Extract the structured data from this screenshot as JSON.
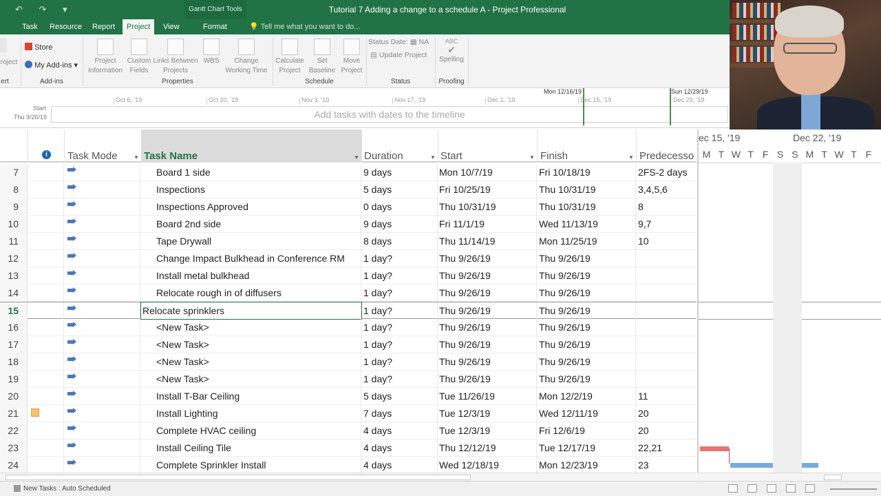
{
  "titlebar": {
    "qat": "↶ ↷ ▾",
    "contextual_tools": "Gantt Chart Tools",
    "doc_title": "Tutorial 7 Adding a change to a schedule A - Project Professional"
  },
  "tabs": [
    "Task",
    "Resource",
    "Report",
    "Project",
    "View",
    "Format"
  ],
  "active_tab": "Project",
  "tell_me": "Tell me what you want to do...",
  "ribbon": {
    "partial_left": "roject",
    "partial_group_left": "ert",
    "store": "Store",
    "my_addins": "My Add-ins",
    "addins_group": "Add-ins",
    "project_information": "Project Information",
    "custom_fields": "Custom Fields",
    "links_between_projects": "Links Between Projects",
    "wbs": "WBS",
    "change_working_time": "Change Working Time",
    "properties_group": "Properties",
    "calculate_project": "Calculate Project",
    "set_baseline": "Set Baseline",
    "move_project": "Move Project",
    "schedule_group": "Schedule",
    "status_date": "Status Date:",
    "status_date_value": "NA",
    "update_project": "Update Project",
    "status_group": "Status",
    "spelling": "Spelling",
    "proofing_group": "Proofing"
  },
  "timeline": {
    "start_label": "Start",
    "start_date": "Thu 9/26/19",
    "placeholder": "Add tasks with dates to the timeline",
    "dates": [
      "Oct 6, '19",
      "Oct 20, '19",
      "Nov 3, '19",
      "Nov 17, '19",
      "Dec 1, '19",
      "Dec 15, '19",
      "Dec 29, '19"
    ],
    "marker_a": "Mon 12/16/19",
    "marker_b": "Sun 12/29/19"
  },
  "columns": {
    "task_mode": "Task Mode",
    "task_name": "Task Name",
    "duration": "Duration",
    "start": "Start",
    "finish": "Finish",
    "predecessors": "Predecesso"
  },
  "editing_value": "Relocate sprinklers",
  "rows": [
    {
      "id": "7",
      "name": "Board 1 side",
      "duration": "9 days",
      "start": "Mon 10/7/19",
      "finish": "Fri 10/18/19",
      "pred": "2FS-2 days"
    },
    {
      "id": "8",
      "name": "Inspections",
      "duration": "5 days",
      "start": "Fri 10/25/19",
      "finish": "Thu 10/31/19",
      "pred": "3,4,5,6"
    },
    {
      "id": "9",
      "name": "Inspections Approved",
      "duration": "0 days",
      "start": "Thu 10/31/19",
      "finish": "Thu 10/31/19",
      "pred": "8"
    },
    {
      "id": "10",
      "name": "Board 2nd side",
      "duration": "9 days",
      "start": "Fri 11/1/19",
      "finish": "Wed 11/13/19",
      "pred": "9,7"
    },
    {
      "id": "11",
      "name": "Tape Drywall",
      "duration": "8 days",
      "start": "Thu 11/14/19",
      "finish": "Mon 11/25/19",
      "pred": "10"
    },
    {
      "id": "12",
      "name": "Change Impact Bulkhead in Conference RM",
      "duration": "1 day?",
      "start": "Thu 9/26/19",
      "finish": "Thu 9/26/19",
      "pred": ""
    },
    {
      "id": "13",
      "name": "Install metal bulkhead",
      "duration": "1 day?",
      "start": "Thu 9/26/19",
      "finish": "Thu 9/26/19",
      "pred": ""
    },
    {
      "id": "14",
      "name": "Relocate rough in of diffusers",
      "duration": "1 day?",
      "start": "Thu 9/26/19",
      "finish": "Thu 9/26/19",
      "pred": ""
    },
    {
      "id": "15",
      "name": "",
      "duration": "1 day?",
      "start": "Thu 9/26/19",
      "finish": "Thu 9/26/19",
      "pred": ""
    },
    {
      "id": "16",
      "name": "<New Task>",
      "duration": "1 day?",
      "start": "Thu 9/26/19",
      "finish": "Thu 9/26/19",
      "pred": ""
    },
    {
      "id": "17",
      "name": "<New Task>",
      "duration": "1 day?",
      "start": "Thu 9/26/19",
      "finish": "Thu 9/26/19",
      "pred": ""
    },
    {
      "id": "18",
      "name": "<New Task>",
      "duration": "1 day?",
      "start": "Thu 9/26/19",
      "finish": "Thu 9/26/19",
      "pred": ""
    },
    {
      "id": "19",
      "name": "<New Task>",
      "duration": "1 day?",
      "start": "Thu 9/26/19",
      "finish": "Thu 9/26/19",
      "pred": ""
    },
    {
      "id": "20",
      "name": "Install T-Bar Ceiling",
      "duration": "5 days",
      "start": "Tue 11/26/19",
      "finish": "Mon 12/2/19",
      "pred": "11"
    },
    {
      "id": "21",
      "name": "Install Lighting",
      "duration": "7 days",
      "start": "Tue 12/3/19",
      "finish": "Wed 12/11/19",
      "pred": "20"
    },
    {
      "id": "22",
      "name": "Complete HVAC ceiling",
      "duration": "4 days",
      "start": "Tue 12/3/19",
      "finish": "Fri 12/6/19",
      "pred": "20"
    },
    {
      "id": "23",
      "name": "Install Ceiling Tile",
      "duration": "4 days",
      "start": "Thu 12/12/19",
      "finish": "Tue 12/17/19",
      "pred": "22,21"
    },
    {
      "id": "24",
      "name": "Complete Sprinkler Install",
      "duration": "4 days",
      "start": "Wed 12/18/19",
      "finish": "Mon 12/23/19",
      "pred": "23"
    }
  ],
  "selected_row": "15",
  "gantt": {
    "weeks": [
      "ec 15, '19",
      "Dec 22, '19"
    ],
    "days": [
      "M",
      "T",
      "W",
      "T",
      "F",
      "S",
      "S",
      "M",
      "T",
      "W",
      "T",
      "F"
    ]
  },
  "status_bar": "New Tasks : Auto Scheduled",
  "colors": {
    "brand": "#217346",
    "selected_text": "#217346"
  }
}
